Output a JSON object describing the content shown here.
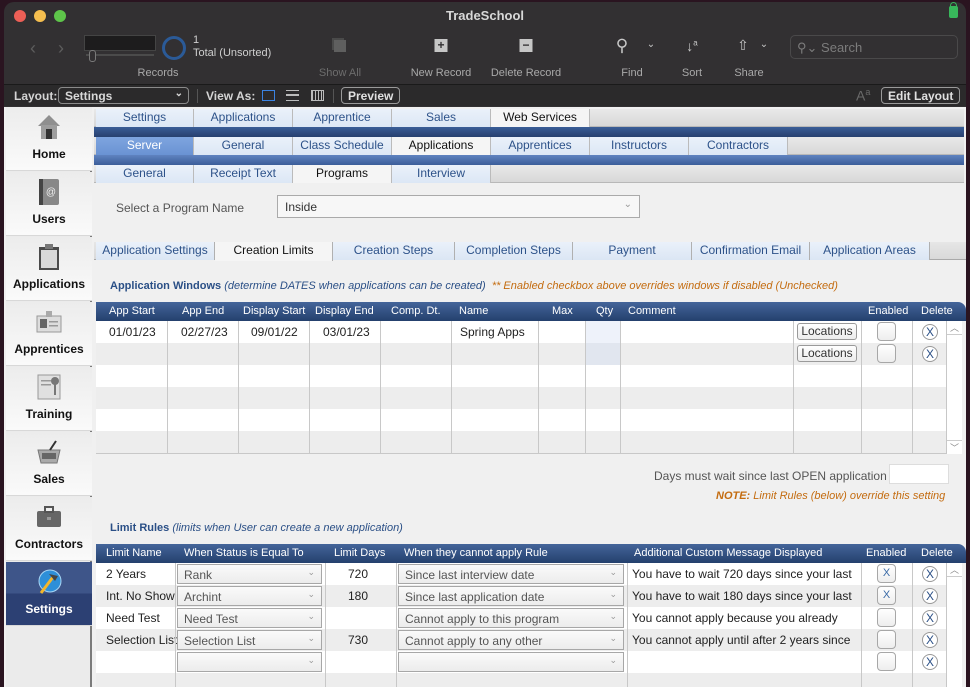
{
  "window": {
    "title": "TradeSchool"
  },
  "toolbar": {
    "records_label": "Records",
    "record_count": "1",
    "record_status": "Total (Unsorted)",
    "show_all": "Show All",
    "new_record": "New Record",
    "delete_record": "Delete Record",
    "find": "Find",
    "sort": "Sort",
    "share": "Share",
    "search_placeholder": "Search"
  },
  "layoutbar": {
    "layout_label": "Layout:",
    "layout_value": "Settings",
    "view_as_label": "View As:",
    "preview": "Preview",
    "edit_layout": "Edit Layout"
  },
  "sidebar": {
    "items": [
      {
        "label": "Home",
        "icon": "house-icon"
      },
      {
        "label": "Users",
        "icon": "address-book-icon"
      },
      {
        "label": "Applications",
        "icon": "clipboard-icon"
      },
      {
        "label": "Apprentices",
        "icon": "id-badge-icon"
      },
      {
        "label": "Training",
        "icon": "certificate-icon"
      },
      {
        "label": "Sales",
        "icon": "basket-icon"
      },
      {
        "label": "Contractors",
        "icon": "briefcase-icon"
      },
      {
        "label": "Settings",
        "icon": "hammer-globe-icon",
        "active": true
      }
    ]
  },
  "tabs": {
    "level1": [
      "Settings",
      "Applications",
      "Apprentice",
      "Sales",
      "Web Services"
    ],
    "level1_selected": "Web Services",
    "level2": [
      "Server",
      "General",
      "Class Schedule",
      "Applications",
      "Apprentices",
      "Instructors",
      "Contractors"
    ],
    "level2_selected": "Applications",
    "level2_highlight": "Server",
    "level3": [
      "General",
      "Receipt Text",
      "Programs",
      "Interview"
    ],
    "level3_selected": "Programs"
  },
  "program": {
    "label": "Select a Program Name",
    "value": "Inside"
  },
  "subtabs": {
    "items": [
      "Application Settings",
      "Creation Limits",
      "Creation Steps",
      "Completion Steps",
      "Payment",
      "Confirmation Email",
      "Application Areas"
    ],
    "selected": "Creation Limits"
  },
  "app_windows": {
    "title": "Application Windows",
    "subtitle": "(determine DATES when applications can be created)",
    "note": "** Enabled checkbox above overrides windows if disabled (Unchecked)",
    "columns": [
      "App Start",
      "App End",
      "Display Start",
      "Display End",
      "Comp. Dt.",
      "Name",
      "Max",
      "Qty",
      "Comment",
      "",
      "Enabled",
      "Delete"
    ],
    "rows": [
      {
        "app_start": "01/01/23",
        "app_end": "02/27/23",
        "display_start": "09/01/22",
        "display_end": "03/01/23",
        "comp_dt": "",
        "name": "Spring Apps",
        "max": "",
        "qty": "",
        "comment": "",
        "locations": "Locations",
        "enabled": "",
        "delete": "X"
      },
      {
        "app_start": "",
        "app_end": "",
        "display_start": "",
        "display_end": "",
        "comp_dt": "",
        "name": "",
        "max": "",
        "qty": "",
        "comment": "",
        "locations": "Locations",
        "enabled": "",
        "delete": "X"
      }
    ],
    "days_wait_label": "Days must wait since last OPEN application",
    "days_wait_value": "",
    "note_bold": "NOTE:",
    "note_text": " Limit Rules (below) override this setting"
  },
  "limit_rules": {
    "title": "Limit Rules",
    "subtitle": "(limits when User can create a new application)",
    "columns": [
      "Limit Name",
      "When Status is Equal To",
      "Limit Days",
      "When they cannot apply Rule",
      "Additional Custom Message Displayed",
      "Enabled",
      "Delete"
    ],
    "rows": [
      {
        "name": "2 Years",
        "status": "Rank",
        "days": "720",
        "rule": "Since last interview date",
        "message": "You have to wait 720 days since your last",
        "enabled": "X",
        "delete": "X"
      },
      {
        "name": "Int. No Show",
        "status": "Archint",
        "days": "180",
        "rule": "Since last application date",
        "message": "You have to wait 180 days since your last",
        "enabled": "X",
        "delete": "X"
      },
      {
        "name": "Need Test",
        "status": "Need Test",
        "days": "",
        "rule": "Cannot apply to this program",
        "message": "You cannot apply because you already",
        "enabled": "",
        "delete": "X"
      },
      {
        "name": "Selection List",
        "status": "Selection List",
        "days": "730",
        "rule": "Cannot apply to any other",
        "message": "You cannot apply until after 2 years since",
        "enabled": "",
        "delete": "X"
      },
      {
        "name": "",
        "status": "",
        "days": "",
        "rule": "",
        "message": "",
        "enabled": "",
        "delete": "X"
      }
    ]
  }
}
